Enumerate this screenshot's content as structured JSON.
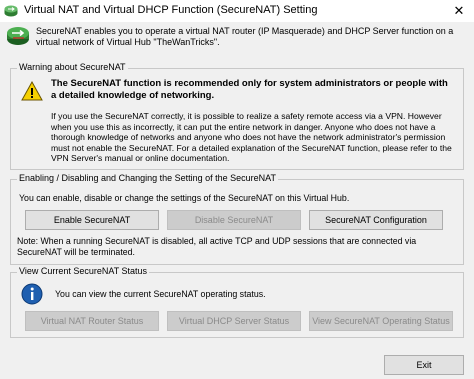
{
  "window": {
    "title": "Virtual NAT and Virtual DHCP Function (SecureNAT) Setting",
    "close_glyph": "✕"
  },
  "intro": "SecureNAT enables you to operate a virtual NAT router (IP Masquerade) and DHCP Server function on a virtual network of Virtual Hub \"TheWanTricks\".",
  "warning": {
    "group_label": "Warning about SecureNAT",
    "icon": "warning-icon",
    "heading": "The SecureNAT function is recommended only for system administrators or people with a detailed knowledge of networking.",
    "body": "If you use the SecureNAT correctly, it is possible to realize a safety remote access via a VPN. However when you use this as incorrectly, it can put the entire network in danger. Anyone who does not have a thorough knowledge of networks and anyone who does not have the network administrator's permission must not enable the SecureNAT. For a detailed explanation of the SecureNAT function, please refer to the VPN Server's manual or online documentation."
  },
  "enable": {
    "group_label": "Enabling / Disabling and Changing the Setting of the SecureNAT",
    "description": "You can enable, disable or change the settings of the SecureNAT on this Virtual Hub.",
    "enable_label": "Enable SecureNAT",
    "disable_label": "Disable SecureNAT",
    "config_label": "SecureNAT Configuration",
    "note": "Note: When a running SecureNAT is disabled, all active TCP and UDP sessions that are connected via SecureNAT will be terminated."
  },
  "status": {
    "group_label": "View Current SecureNAT Status",
    "icon": "info-icon",
    "description": "You can view the current SecureNAT operating status.",
    "router_label": "Virtual NAT Router Status",
    "dhcp_label": "Virtual DHCP Server Status",
    "operating_label": "View SecureNAT Operating Status"
  },
  "footer": {
    "exit_label": "Exit"
  },
  "colors": {
    "warning_yellow": "#f5d000",
    "info_blue": "#1f5fb0",
    "disabled_bg": "#cccccc"
  }
}
